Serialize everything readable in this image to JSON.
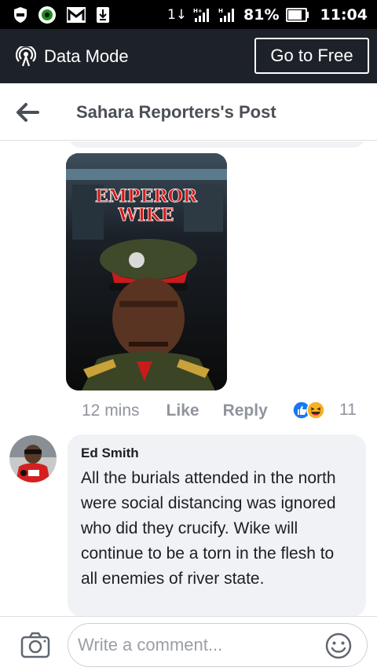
{
  "status_bar": {
    "battery_percent": "81%",
    "time": "11:04",
    "signal_prefix": "1↓",
    "icons": [
      "shield-icon",
      "app-circle-icon",
      "mail-icon",
      "download-icon",
      "data-transfer-icon",
      "signal-4g-icon",
      "signal-4g-icon",
      "battery-icon"
    ]
  },
  "data_bar": {
    "label": "Data Mode",
    "button_label": "Go to Free",
    "icon": "data-mode-icon"
  },
  "header": {
    "title": "Sahara Reporters's Post",
    "back_icon": "back-arrow-icon"
  },
  "post": {
    "image_caption_line1": "EMPEROR",
    "image_caption_line2": "WIKE",
    "time": "12 mins",
    "like_label": "Like",
    "reply_label": "Reply",
    "reaction_count": "11",
    "reaction_icons": [
      "like-reaction-icon",
      "haha-reaction-icon"
    ]
  },
  "comment": {
    "author": "Ed Smith",
    "text": "All the burials attended in the north were social distancing was ignored who did they crucify. Wike will continue to be a torn in the flesh to all enemies of river state."
  },
  "composer": {
    "placeholder": "Write a comment...",
    "camera_icon": "camera-icon",
    "emoji_icon": "emoji-icon"
  },
  "colors": {
    "status_bar_bg": "#000000",
    "data_bar_bg": "#1d2129",
    "reaction_blue": "#1877f2",
    "meta_gray": "#90949c",
    "bubble_bg": "#f0f2f5"
  }
}
